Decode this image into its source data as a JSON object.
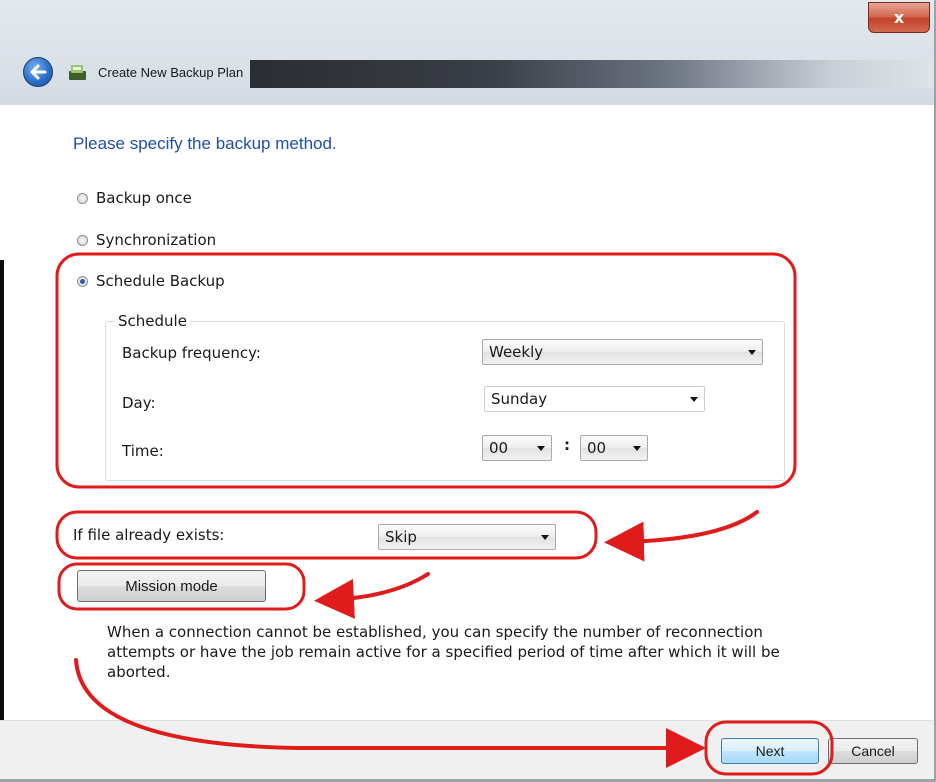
{
  "window": {
    "title": "Create New Backup Plan",
    "close_glyph": "x"
  },
  "heading": "Please specify the backup method.",
  "method": {
    "options": [
      {
        "label": "Backup once",
        "selected": false
      },
      {
        "label": "Synchronization",
        "selected": false
      },
      {
        "label": "Schedule Backup",
        "selected": true
      }
    ]
  },
  "schedule": {
    "legend": "Schedule",
    "frequency_label": "Backup frequency:",
    "frequency_value": "Weekly",
    "day_label": "Day:",
    "day_value": "Sunday",
    "time_label": "Time:",
    "hour_value": "00",
    "time_separator": ":",
    "minute_value": "00"
  },
  "file_exists": {
    "label": "If file already exists:",
    "value": "Skip"
  },
  "mission_mode_label": "Mission mode",
  "description": "When a connection cannot be established, you can specify the number of reconnection attempts or have the job remain active for a specified period of time after which it will be aborted.",
  "footer": {
    "next_label": "Next",
    "cancel_label": "Cancel"
  },
  "icons": {
    "back": "back-arrow-icon",
    "app": "backup-app-icon",
    "close": "close-icon",
    "dropdown": "chevron-down-icon"
  },
  "colors": {
    "heading": "#1f4fa8",
    "annotation": "#e01b1b",
    "close_button": "#c2412a",
    "primary_button_border": "#3c7fb1"
  }
}
